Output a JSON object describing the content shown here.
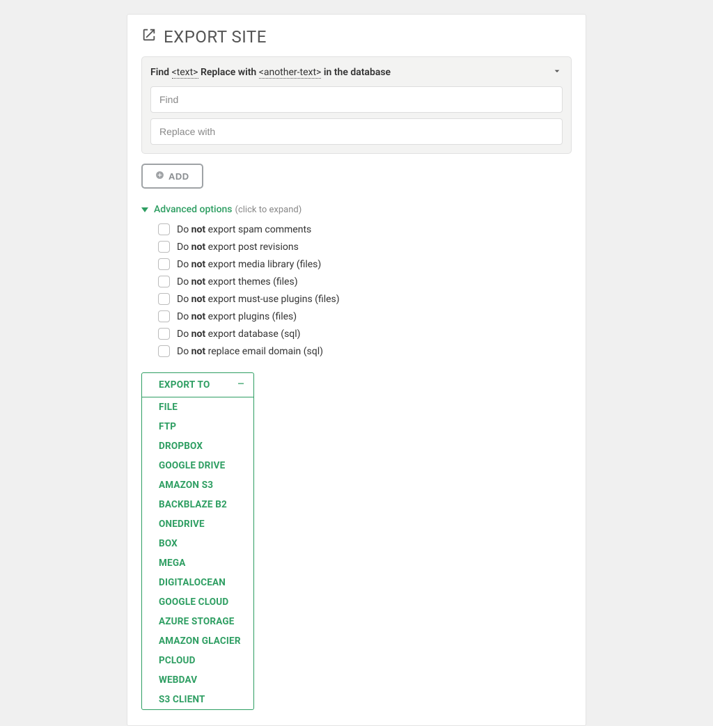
{
  "page": {
    "title": "EXPORT SITE"
  },
  "find_replace": {
    "header": {
      "prefix": "Find",
      "token1": "<text>",
      "mid": "Replace with",
      "token2": "<another-text>",
      "suffix": "in the database"
    },
    "find_placeholder": "Find",
    "replace_placeholder": "Replace with"
  },
  "add_button": {
    "label": "ADD"
  },
  "advanced": {
    "label": "Advanced options",
    "hint": "(click to expand)",
    "options": [
      {
        "pre": "Do ",
        "bold": "not",
        "post": " export spam comments"
      },
      {
        "pre": "Do ",
        "bold": "not",
        "post": " export post revisions"
      },
      {
        "pre": "Do ",
        "bold": "not",
        "post": " export media library (files)"
      },
      {
        "pre": "Do ",
        "bold": "not",
        "post": " export themes (files)"
      },
      {
        "pre": "Do ",
        "bold": "not",
        "post": " export must-use plugins (files)"
      },
      {
        "pre": "Do ",
        "bold": "not",
        "post": " export plugins (files)"
      },
      {
        "pre": "Do ",
        "bold": "not",
        "post": " export database (sql)"
      },
      {
        "pre": "Do ",
        "bold": "not",
        "post": " replace email domain (sql)"
      }
    ]
  },
  "export_menu": {
    "header": "EXPORT TO",
    "items": [
      "FILE",
      "FTP",
      "DROPBOX",
      "GOOGLE DRIVE",
      "AMAZON S3",
      "BACKBLAZE B2",
      "ONEDRIVE",
      "BOX",
      "MEGA",
      "DIGITALOCEAN",
      "GOOGLE CLOUD",
      "AZURE STORAGE",
      "AMAZON GLACIER",
      "PCLOUD",
      "WEBDAV",
      "S3 CLIENT"
    ]
  },
  "colors": {
    "accent": "#2e9e62"
  }
}
